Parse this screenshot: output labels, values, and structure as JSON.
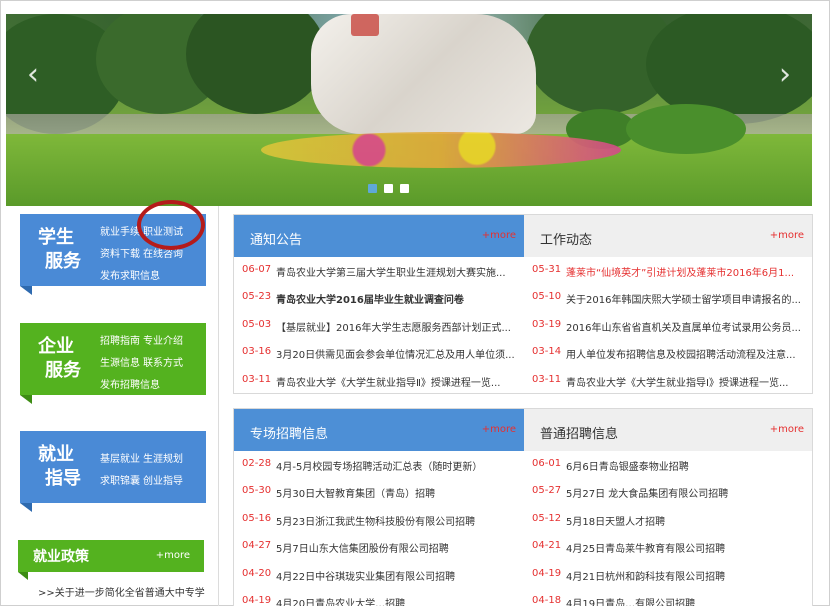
{
  "banner": {
    "prev_symbol": "‹",
    "next_symbol": "›",
    "slides": 3,
    "active_slide": 1
  },
  "services": [
    {
      "title_1": "学生",
      "title_2": "服务",
      "color": "#4a8ad6",
      "links": [
        "就业手续",
        "职业测试",
        "资料下载",
        "在线咨询",
        "发布求职信息"
      ]
    },
    {
      "title_1": "企业",
      "title_2": "服务",
      "color": "#54b21f",
      "links": [
        "招聘指南",
        "专业介绍",
        "生源信息",
        "联系方式",
        "发布招聘信息"
      ]
    },
    {
      "title_1": "就业",
      "title_2": "指导",
      "color": "#4a8ad6",
      "links": [
        "基层就业",
        "生涯规划",
        "求职锦囊",
        "创业指导"
      ]
    }
  ],
  "policy": {
    "title": "就业政策",
    "more": "+more",
    "item": ">>关于进一步简化全省普通大中专学"
  },
  "panel1": {
    "left": {
      "title": "通知公告",
      "more": "+more",
      "items": [
        {
          "date": "06-07",
          "text": "青岛农业大学第三届大学生职业生涯规划大赛实施...",
          "style": ""
        },
        {
          "date": "05-23",
          "text": "青岛农业大学2016届毕业生就业调查问卷",
          "style": "bold"
        },
        {
          "date": "05-03",
          "text": "【基层就业】2016年大学生志愿服务西部计划正式...",
          "style": ""
        },
        {
          "date": "03-16",
          "text": "3月20日供需见面会参会单位情况汇总及用人单位须...",
          "style": ""
        },
        {
          "date": "03-11",
          "text": "青岛农业大学《大学生就业指导Ⅱ》授课进程一览...",
          "style": ""
        }
      ]
    },
    "right": {
      "title": "工作动态",
      "more": "+more",
      "items": [
        {
          "date": "05-31",
          "text": "蓬莱市“仙境英才”引进计划及蓬莱市2016年6月1...",
          "style": "red"
        },
        {
          "date": "05-10",
          "text": "关于2016年韩国庆熙大学硕士留学项目申请报名的...",
          "style": ""
        },
        {
          "date": "03-19",
          "text": "2016年山东省省直机关及直属单位考试录用公务员...",
          "style": ""
        },
        {
          "date": "03-14",
          "text": "用人单位发布招聘信息及校园招聘活动流程及注意...",
          "style": ""
        },
        {
          "date": "03-11",
          "text": "青岛农业大学《大学生就业指导Ⅰ》授课进程一览...",
          "style": ""
        }
      ]
    }
  },
  "panel2": {
    "left": {
      "title": "专场招聘信息",
      "more": "+more",
      "items": [
        {
          "date": "02-28",
          "text": "4月-5月校园专场招聘活动汇总表（随时更新）",
          "style": ""
        },
        {
          "date": "05-30",
          "text": "5月30日大智教育集团（青岛）招聘",
          "style": ""
        },
        {
          "date": "05-16",
          "text": "5月23日浙江我武生物科技股份有限公司招聘",
          "style": ""
        },
        {
          "date": "04-27",
          "text": "5月7日山东大信集团股份有限公司招聘",
          "style": ""
        },
        {
          "date": "04-20",
          "text": "4月22日中谷琪珑实业集团有限公司招聘",
          "style": ""
        },
        {
          "date": "04-19",
          "text": "4月20日青岛农业大学…招聘",
          "style": ""
        }
      ]
    },
    "right": {
      "title": "普通招聘信息",
      "more": "+more",
      "items": [
        {
          "date": "06-01",
          "text": "6月6日青岛银盛泰物业招聘",
          "style": ""
        },
        {
          "date": "05-27",
          "text": "5月27日 龙大食品集团有限公司招聘",
          "style": ""
        },
        {
          "date": "05-12",
          "text": "5月18日天盟人才招聘",
          "style": ""
        },
        {
          "date": "04-21",
          "text": "4月25日青岛莱牛教育有限公司招聘",
          "style": ""
        },
        {
          "date": "04-19",
          "text": "4月21日杭州和韵科技有限公司招聘",
          "style": ""
        },
        {
          "date": "04-18",
          "text": "4月19日青岛…有限公司招聘",
          "style": ""
        }
      ]
    }
  }
}
